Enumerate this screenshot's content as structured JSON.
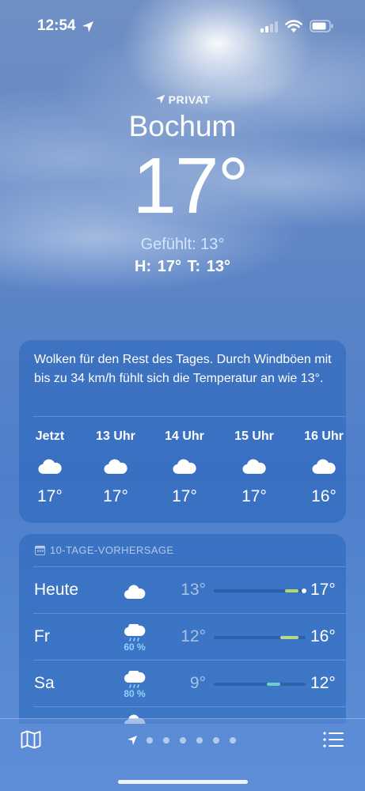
{
  "status_bar": {
    "time": "12:54"
  },
  "location": {
    "label": "PRIVAT",
    "city": "Bochum"
  },
  "current": {
    "temp": "17°",
    "feels_like": "Gefühlt: 13°",
    "high_low": "H: 17°  T: 13°"
  },
  "hourly": {
    "summary": "Wolken für den Rest des Tages. Durch Windböen mit bis zu 34 km/h fühlt sich die Temperatur an wie 13°.",
    "items": [
      {
        "time": "Jetzt",
        "icon": "cloud-icon",
        "temp": "17°"
      },
      {
        "time": "13 Uhr",
        "icon": "cloud-icon",
        "temp": "17°"
      },
      {
        "time": "14 Uhr",
        "icon": "cloud-icon",
        "temp": "17°"
      },
      {
        "time": "15 Uhr",
        "icon": "cloud-icon",
        "temp": "17°"
      },
      {
        "time": "16 Uhr",
        "icon": "cloud-icon",
        "temp": "16°"
      }
    ]
  },
  "daily": {
    "header": "10-TAGE-VORHERSAGE",
    "days": [
      {
        "day": "Heute",
        "icon": "cloud-icon",
        "precip": "",
        "low": "13°",
        "high": "17°",
        "bar_start": 0.78,
        "bar_end": 0.92,
        "current_marker": 0.98,
        "bar_color": "#b9d66a"
      },
      {
        "day": "Fr",
        "icon": "cloud-rain-icon",
        "precip": "60 %",
        "low": "12°",
        "high": "16°",
        "bar_start": 0.72,
        "bar_end": 0.92,
        "bar_color": "#b7d987"
      },
      {
        "day": "Sa",
        "icon": "cloud-rain-icon",
        "precip": "80 %",
        "low": "9°",
        "high": "12°",
        "bar_start": 0.58,
        "bar_end": 0.72,
        "bar_color": "#6ad0c6"
      }
    ]
  },
  "colors": {
    "accent_feels": "#cfe6ff",
    "precip": "#8fd1ff"
  }
}
